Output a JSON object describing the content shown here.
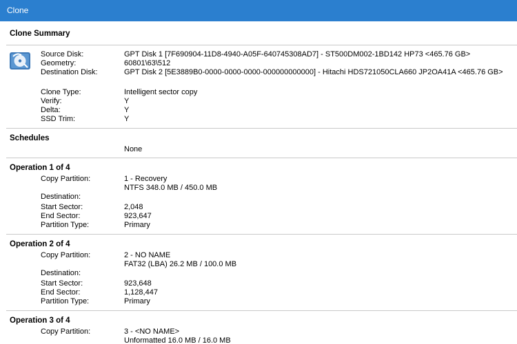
{
  "window": {
    "title": "Clone"
  },
  "summary": {
    "heading": "Clone Summary",
    "source_label": "Source Disk:",
    "source_value": "GPT Disk 1 [7F690904-11D8-4940-A05F-640745308AD7] - ST500DM002-1BD142 HP73  <465.76 GB>",
    "geometry_label": "Geometry:",
    "geometry_value": "60801\\63\\512",
    "dest_label": "Destination Disk:",
    "dest_value": "GPT Disk 2 [5E3889B0-0000-0000-0000-000000000000] - Hitachi HDS721050CLA660 JP2OA41A  <465.76 GB>",
    "clone_type_label": "Clone Type:",
    "clone_type_value": "Intelligent sector copy",
    "verify_label": "Verify:",
    "verify_value": "Y",
    "delta_label": "Delta:",
    "delta_value": "Y",
    "ssd_label": "SSD Trim:",
    "ssd_value": "Y"
  },
  "schedules": {
    "heading": "Schedules",
    "value": "None"
  },
  "operations": [
    {
      "heading": "Operation 1 of 4",
      "copy_label": "Copy Partition:",
      "copy_line1": "1 - Recovery",
      "copy_line2": "NTFS 348.0 MB / 450.0 MB",
      "dest_label": "Destination:",
      "start_label": "Start Sector:",
      "start_value": "2,048",
      "end_label": "End Sector:",
      "end_value": "923,647",
      "type_label": "Partition Type:",
      "type_value": "Primary"
    },
    {
      "heading": "Operation 2 of 4",
      "copy_label": "Copy Partition:",
      "copy_line1": "2 - NO NAME",
      "copy_line2": "FAT32 (LBA) 26.2 MB / 100.0 MB",
      "dest_label": "Destination:",
      "start_label": "Start Sector:",
      "start_value": "923,648",
      "end_label": "End Sector:",
      "end_value": "1,128,447",
      "type_label": "Partition Type:",
      "type_value": "Primary"
    },
    {
      "heading": "Operation 3 of 4",
      "copy_label": "Copy Partition:",
      "copy_line1": "3 - <NO NAME>",
      "copy_line2": "Unformatted 16.0 MB / 16.0 MB"
    }
  ]
}
